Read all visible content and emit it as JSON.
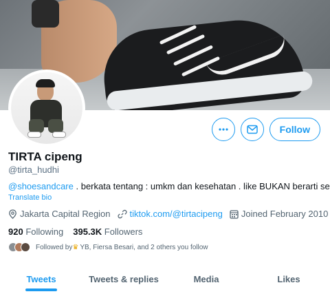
{
  "profile": {
    "name": "TIRTA cipeng",
    "handle": "@tirta_hudhi",
    "bio_mention": "@shoesandcare",
    "bio_text": " . berkata tentang : umkm dan kesehatan . like BUKAN berarti setuju",
    "translate_label": "Translate bio",
    "location": "Jakarta Capital Region",
    "website": "tiktok.com/@tirtacipeng",
    "joined": "Joined February 2010"
  },
  "stats": {
    "following_count": "920",
    "following_label": "Following",
    "followers_count": "395.3K",
    "followers_label": "Followers"
  },
  "followed_by": {
    "prefix": "Followed by ",
    "names": "YB, Fiersa Besari, and 2 others you follow"
  },
  "actions": {
    "more_icon": "more-icon",
    "message_icon": "mail-icon",
    "follow_label": "Follow"
  },
  "tabs": [
    {
      "label": "Tweets",
      "active": true
    },
    {
      "label": "Tweets & replies",
      "active": false
    },
    {
      "label": "Media",
      "active": false
    },
    {
      "label": "Likes",
      "active": false
    }
  ],
  "colors": {
    "accent": "#1d9bf0",
    "text": "#0f1419",
    "secondary": "#536471"
  }
}
